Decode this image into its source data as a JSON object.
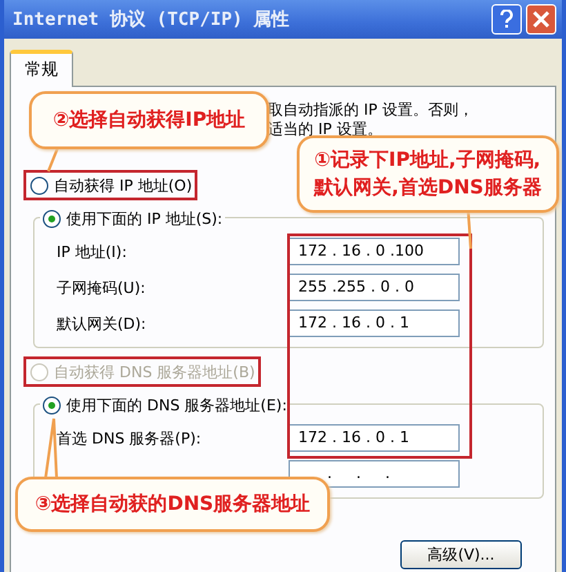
{
  "window": {
    "title": "Internet 协议 (TCP/IP) 属性"
  },
  "tabs": [
    {
      "label": "常规",
      "selected": true
    }
  ],
  "intro": [
    "取自动指派的 IP 设置。否则，",
    "适当的 IP 设置。"
  ],
  "ip_auto": {
    "label": "自动获得 IP 地址(O)",
    "selected": false,
    "disabled": false
  },
  "ip_manual": {
    "radio": {
      "label": "使用下面的 IP 地址(S):",
      "selected": true,
      "disabled": false
    },
    "rows": [
      {
        "label": "IP 地址(I):",
        "value": "172 . 16 . 0 .100"
      },
      {
        "label": "子网掩码(U):",
        "value": "255 .255 . 0 . 0"
      },
      {
        "label": "默认网关(D):",
        "value": "172 . 16 . 0 . 1"
      }
    ]
  },
  "dns_auto": {
    "label": "自动获得 DNS 服务器地址(B)",
    "selected": false,
    "disabled": true
  },
  "dns_manual": {
    "radio": {
      "label": "使用下面的 DNS 服务器地址(E):",
      "selected": true,
      "disabled": false
    },
    "rows": [
      {
        "label": "首选 DNS 服务器(P):",
        "value": "172 . 16 . 0 . 1"
      },
      {
        "value": "      .     .     ."
      }
    ]
  },
  "buttons": [
    "高级(V)..."
  ],
  "callouts": [
    {
      "text": "②选择自动获得IP地址"
    },
    {
      "text": "①记录下IP地址,子网掩码,\n默认网关,首选DNS服务器"
    },
    {
      "text": "③选择自动获的DNS服务器地址"
    }
  ]
}
